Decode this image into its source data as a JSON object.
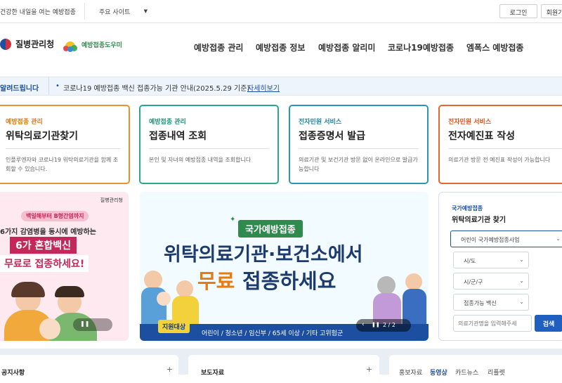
{
  "util": {
    "slogan": "건강한 내일을 여는 예방접종",
    "site_select": "주요 사이트",
    "login": "로그인",
    "join": "회원가"
  },
  "header": {
    "logo_text": "질병관리청",
    "sub_logo_text": "예방접종도우미",
    "nav": [
      "예방접종 관리",
      "예방접종 정보",
      "예방접종 알리미",
      "코로나19예방접종",
      "엠폭스 예방접종"
    ]
  },
  "notice": {
    "label": "알려드립니다",
    "text": "코로나19 예방접종 백신 접종가능 기관 안내(2025.5.29 기준)",
    "more": "자세히보기"
  },
  "services": [
    {
      "category": "예방접종 관리",
      "title": "위탁의료기관찾기",
      "desc": "인플루엔자와 코로나19 위탁의료기관을 함께 조회할 수 있습니다.",
      "color": "#e8932b"
    },
    {
      "category": "예방접종 관리",
      "title": "접종내역 조회",
      "desc": "본인 및 자녀의 예방접종 내역을 조회합니다",
      "color": "#27a88f"
    },
    {
      "category": "전자민원 서비스",
      "title": "접종증명서 발급",
      "desc": "의료기관 및 보건기관 방문 없이 온라인으로 발급가능합니다",
      "color": "#2797b5"
    },
    {
      "category": "전자민원 서비스",
      "title": "전자예진표 작성",
      "desc": "의료기관 방문 전 예진표 작성이 가능합니다",
      "color": "#e8652b"
    }
  ],
  "banner1": {
    "badge": "질병관리청",
    "line1": "백일해부터 B형간염까지",
    "line2": "6가지 감염병을 동시에 예방하는",
    "line3": "6가 혼합백신",
    "line4": "무료로 접종하세요!"
  },
  "banner2": {
    "tag": "국가예방접종",
    "line1": "위탁의료기관·보건소에서",
    "line2a": "무료",
    "line2b": " 접종하세요",
    "target_label": "지원대상",
    "targets": "어린이 / 청소년 / 임신부 / 65세 이상 / 기타 고위험군",
    "page": "2 / 2"
  },
  "finder": {
    "category": "국가예방접종",
    "title": "위탁의료기관 찾기",
    "program": "어린이 국가예방접종사업",
    "sido": "시/도",
    "sigungu": "시/군/구",
    "vaccine": "접종가능 백신",
    "placeholder": "의료기관명을 입력해주세",
    "search": "검색"
  },
  "bottom": {
    "notice_title": "공지사항",
    "press_title": "보도자료",
    "promo_tabs": [
      "홍보자료",
      "동영상",
      "카드뉴스",
      "리플렛"
    ]
  },
  "colors": {
    "accent": "#1b4fa3",
    "search_btn": "#1f5fbf"
  }
}
